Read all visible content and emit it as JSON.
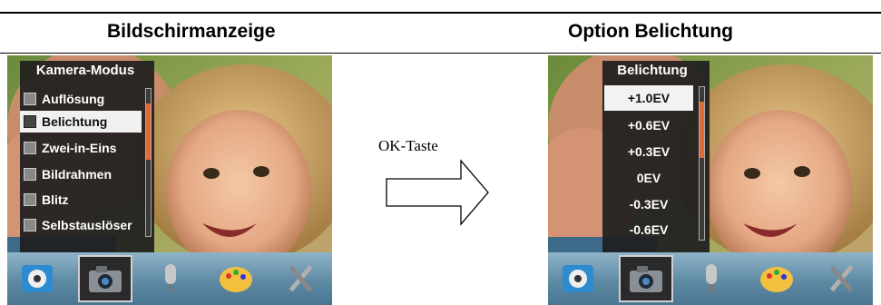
{
  "left": {
    "heading": "Bildschirmanzeige",
    "menu": {
      "title": "Kamera-Modus",
      "items": [
        {
          "label": "Auflösung",
          "icon": "resolution-icon"
        },
        {
          "label": "Belichtung",
          "icon": "exposure-icon",
          "selected": true
        },
        {
          "label": "Zwei-in-Eins",
          "icon": "two-in-one-icon"
        },
        {
          "label": "Bildrahmen",
          "icon": "frame-icon"
        },
        {
          "label": "Blitz",
          "icon": "flash-icon"
        },
        {
          "label": "Selbstauslöser",
          "icon": "self-timer-icon"
        }
      ]
    }
  },
  "arrow": {
    "label": "OK-Taste"
  },
  "right": {
    "heading": "Option Belichtung",
    "menu": {
      "title": "Belichtung",
      "items": [
        {
          "label": "+1.0EV",
          "selected": true
        },
        {
          "label": "+0.6EV"
        },
        {
          "label": "+0.3EV"
        },
        {
          "label": "0EV"
        },
        {
          "label": "-0.3EV"
        },
        {
          "label": "-0.6EV"
        }
      ]
    }
  },
  "toolbar": {
    "icons": [
      "video-mode-icon",
      "camera-mode-icon",
      "voice-mode-icon",
      "effects-palette-icon",
      "settings-tools-icon"
    ],
    "selected": "camera-mode-icon"
  },
  "colors": {
    "menu_bg": "#1e1e1e",
    "selection_bg": "#f0f0f0",
    "scroll_thumb": "#e06a3a",
    "toolbar_top": "#8fb4c9",
    "toolbar_bottom": "#4a7590"
  }
}
